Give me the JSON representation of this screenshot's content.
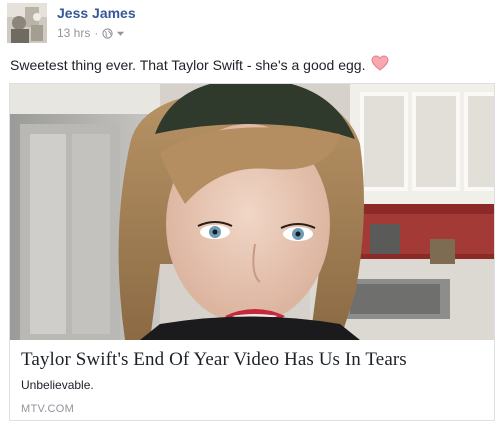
{
  "post": {
    "author": "Jess James",
    "timestamp": "13 hrs",
    "separator": "·",
    "privacy_icon": "globe-icon",
    "menu_icon": "chevron-down-icon",
    "status_text": "Sweetest thing ever. That Taylor Swift - she's a good egg.",
    "emoji": "heart-icon",
    "colors": {
      "author_link": "#365899",
      "meta_text": "#90949c",
      "heart_fill": "#f7a8b0",
      "heart_stroke": "#e8808c"
    }
  },
  "link_card": {
    "title": "Taylor Swift's End Of Year Video Has Us In Tears",
    "description": "Unbelievable.",
    "domain": "MTV.COM"
  }
}
